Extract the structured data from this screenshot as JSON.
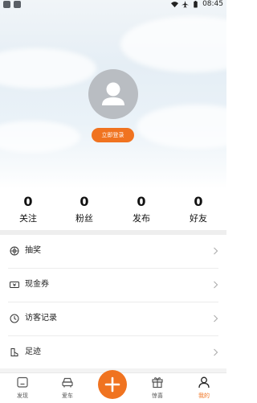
{
  "status_bar": {
    "time": "08:45"
  },
  "profile": {
    "login_label": "立即登录"
  },
  "stats": [
    {
      "value": "0",
      "label": "关注"
    },
    {
      "value": "0",
      "label": "粉丝"
    },
    {
      "value": "0",
      "label": "发布"
    },
    {
      "value": "0",
      "label": "好友"
    }
  ],
  "menu": [
    {
      "label": "抽奖",
      "icon": "lottery-icon"
    },
    {
      "label": "现金券",
      "icon": "cash-coupon-icon"
    },
    {
      "label": "访客记录",
      "icon": "clock-icon"
    },
    {
      "label": "足迹",
      "icon": "footprint-icon"
    }
  ],
  "tabbar": {
    "items": [
      {
        "label": "发现",
        "icon": "discover-icon"
      },
      {
        "label": "爱车",
        "icon": "car-icon"
      },
      {
        "label": "惊喜",
        "icon": "gift-icon"
      },
      {
        "label": "我的",
        "icon": "profile-icon"
      }
    ],
    "active": "我的",
    "fab_icon": "plus-icon"
  },
  "colors": {
    "accent": "#f07320",
    "avatar_bg": "#b9bdc2"
  }
}
